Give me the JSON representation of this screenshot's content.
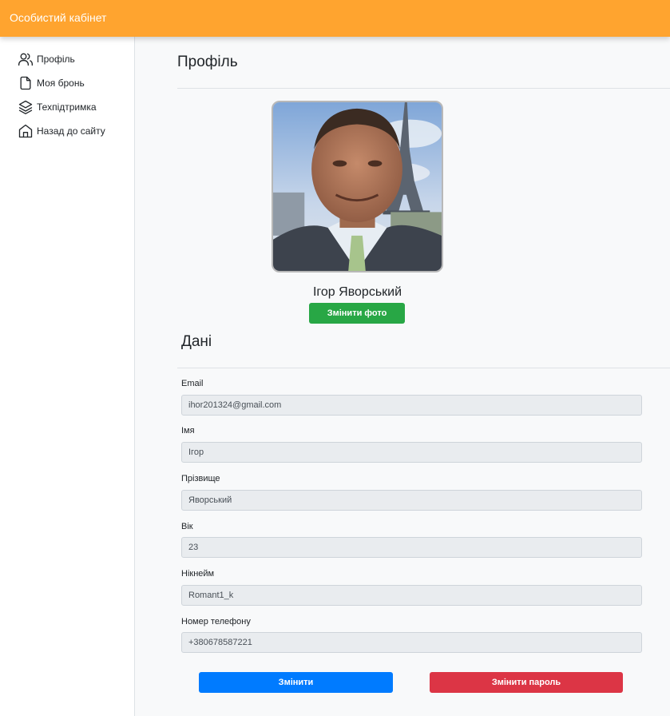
{
  "header": {
    "title": "Особистий кабінет"
  },
  "sidebar": {
    "items": [
      {
        "label": "Профіль",
        "icon": "users-icon"
      },
      {
        "label": "Моя бронь",
        "icon": "file-icon"
      },
      {
        "label": "Техпідтримка",
        "icon": "layers-icon"
      },
      {
        "label": "Назад до сайту",
        "icon": "home-icon"
      }
    ]
  },
  "profile": {
    "section_title": "Профіль",
    "user_name": "Ігор Яворський",
    "change_photo_label": "Змінити фото"
  },
  "data_section": {
    "title": "Дані",
    "fields": [
      {
        "label": "Email",
        "value": "ihor201324@gmail.com"
      },
      {
        "label": "Імя",
        "value": "Ігор"
      },
      {
        "label": "Прізвище",
        "value": "Яворський"
      },
      {
        "label": "Вік",
        "value": "23"
      },
      {
        "label": "Нікнейм",
        "value": "Romant1_k"
      },
      {
        "label": "Номер телефону",
        "value": "+380678587221"
      }
    ],
    "change_label": "Змінити",
    "change_password_label": "Змінити пароль"
  },
  "colors": {
    "header": "#ffa42f",
    "green": "#28a745",
    "blue": "#007bff",
    "red": "#dc3545"
  }
}
